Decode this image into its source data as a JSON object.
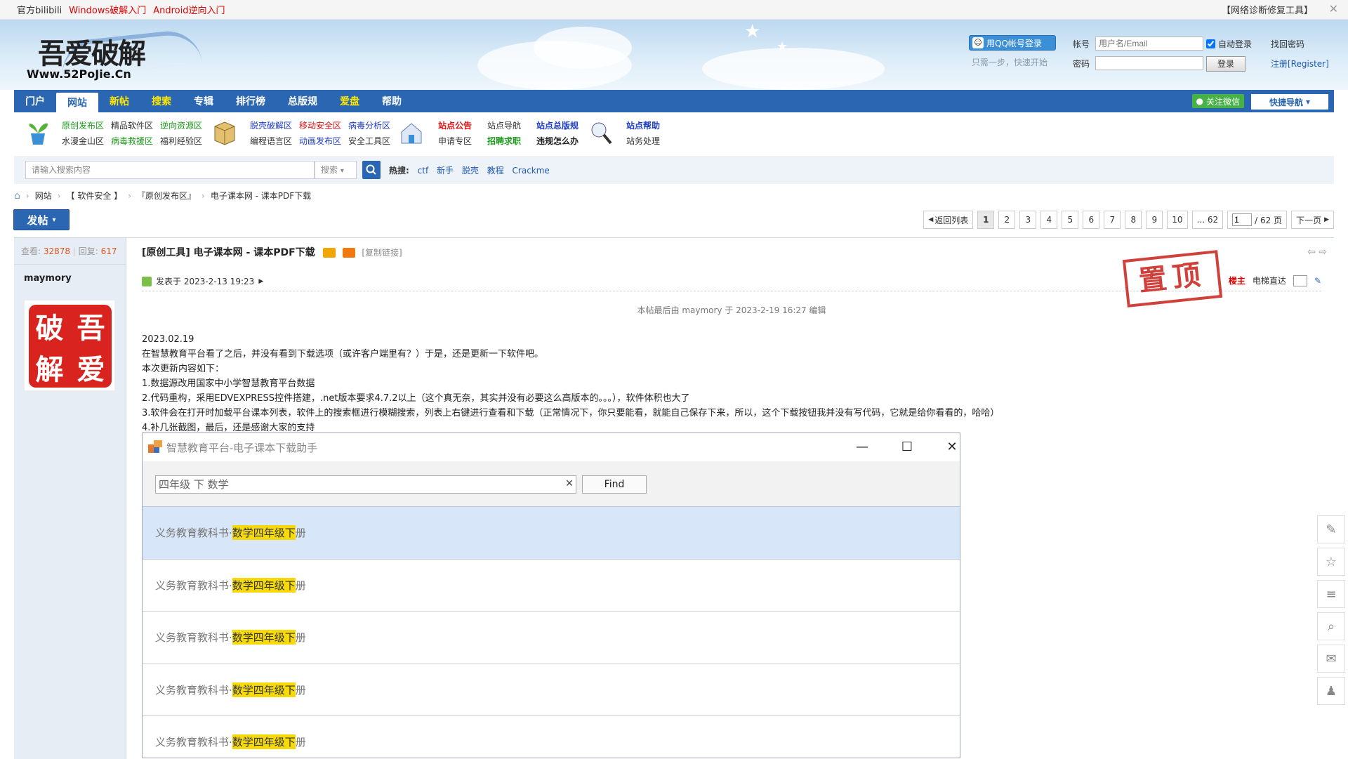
{
  "topbar": {
    "left": [
      "官方bilibili",
      "Windows破解入门",
      "Android逆向入门"
    ],
    "right": [
      "【网络诊断修复工具】"
    ]
  },
  "logo": {
    "cn": "吾爱破解",
    "en": "Www.52PoJie.Cn"
  },
  "login": {
    "qq_label": "用QQ帐号登录",
    "hint": "只需一步，快速开始",
    "account_label": "帐号",
    "account_placeholder": "用户名/Email",
    "password_label": "密码",
    "auto_login": "自动登录",
    "login_button": "登录",
    "find_password": "找回密码",
    "register": "注册[Register]"
  },
  "nav": {
    "items": [
      "门户",
      "网站",
      "新帖",
      "搜索",
      "专辑",
      "排行榜",
      "总版规",
      "爱盘",
      "帮助"
    ],
    "active": "网站",
    "wechat": "关注微信",
    "quick_nav": "快捷导航"
  },
  "forum_links": {
    "group1": [
      {
        "text": "原创发布区",
        "color": "green"
      },
      {
        "text": "精品软件区",
        "color": "dark"
      },
      {
        "text": "逆向资源区",
        "color": "green"
      },
      {
        "text": "水漫金山区",
        "color": "dark"
      },
      {
        "text": "病毒救援区",
        "color": "green"
      },
      {
        "text": "福利经验区",
        "color": "dark"
      }
    ],
    "group2": [
      {
        "text": "脱壳破解区",
        "color": "blue"
      },
      {
        "text": "移动安全区",
        "color": "red"
      },
      {
        "text": "病毒分析区",
        "color": "blue"
      },
      {
        "text": "编程语言区",
        "color": "dark"
      },
      {
        "text": "动画发布区",
        "color": "blue"
      },
      {
        "text": "安全工具区",
        "color": "dark"
      }
    ],
    "group3": [
      {
        "text": "站点公告",
        "color": "red"
      },
      {
        "text": "站点导航",
        "color": "dark"
      },
      {
        "text": "站点总版规",
        "color": "blue"
      },
      {
        "text": "申请专区",
        "color": "dark"
      },
      {
        "text": "招聘求职",
        "color": "green"
      },
      {
        "text": "违规怎么办",
        "color": "dark-bold"
      }
    ],
    "group4": [
      {
        "text": "站点帮助",
        "color": "blue"
      },
      {
        "text": "站务处理",
        "color": "dark"
      }
    ]
  },
  "search": {
    "placeholder": "请输入搜索内容",
    "type": "搜索",
    "hot_label": "热搜:",
    "hot_terms": [
      "ctf",
      "新手",
      "脱壳",
      "教程",
      "Crackme"
    ]
  },
  "breadcrumb": [
    "网站",
    "【 软件安全 】",
    "『原创发布区』",
    "电子课本网 - 课本PDF下载"
  ],
  "post_button": "发帖",
  "pager": {
    "back": "返回列表",
    "pages": [
      "1",
      "2",
      "3",
      "4",
      "5",
      "6",
      "7",
      "8",
      "9",
      "10",
      "... 62"
    ],
    "current": "1",
    "input_value": "1",
    "total": "/ 62 页",
    "next": "下一页"
  },
  "thread": {
    "views_label": "查看:",
    "views": "32878",
    "replies_label": "回复:",
    "replies": "617",
    "author": "maymory",
    "avatar_chars": [
      "吾",
      "破",
      "爱",
      "解"
    ],
    "title": "[原创工具] 电子课本网 - 课本PDF下载",
    "copy_link": "[复制链接]",
    "posted": "发表于 2023-2-13 19:23",
    "stamp": "置顶",
    "owner_label": "楼主",
    "elevator_label": "电梯直达",
    "edited": "本帖最后由 maymory 于 2023-2-19 16:27 编辑",
    "content_lines": [
      "2023.02.19",
      "在智慧教育平台看了之后，并没有看到下载选项（或许客户端里有？）于是，还是更新一下软件吧。",
      "本次更新内容如下：",
      "1.数据源改用国家中小学智慧教育平台数据",
      "2.代码重构，采用EDVEXPRESS控件搭建，.net版本要求4.7.2以上（这个真无奈，其实并没有必要这么高版本的。。。），软件体积也大了",
      "3.软件会在打开时加载平台课本列表，软件上的搜索框进行模糊搜索，列表上右键进行查看和下载（正常情况下，你只要能看，就能自己保存下来，所以，这个下载按钮我并没有写代码，它就是给你看看的，哈哈）",
      "4.补几张截图，最后，还是感谢大家的支持"
    ]
  },
  "app_window": {
    "title": "智慧教育平台-电子课本下载助手",
    "search_value": "四年级 下 数学",
    "find_button": "Find",
    "rows": [
      {
        "prefix": "义务教育教科书·",
        "highlight": "数学四年级下",
        "suffix": "册"
      },
      {
        "prefix": "义务教育教科书·",
        "highlight": "数学四年级下",
        "suffix": "册"
      },
      {
        "prefix": "义务教育教科书·",
        "highlight": "数学四年级下",
        "suffix": "册"
      },
      {
        "prefix": "义务教育教科书·",
        "highlight": "数学四年级下",
        "suffix": "册"
      },
      {
        "prefix": "义务教育教科书·",
        "highlight": "数学四年级下",
        "suffix": "册"
      }
    ]
  },
  "colors": {
    "nav_blue": "#2a66b2",
    "highlight_yellow": "#f5d90a",
    "selected_row": "#d7e6f8",
    "stamp_red": "#c8201a"
  }
}
